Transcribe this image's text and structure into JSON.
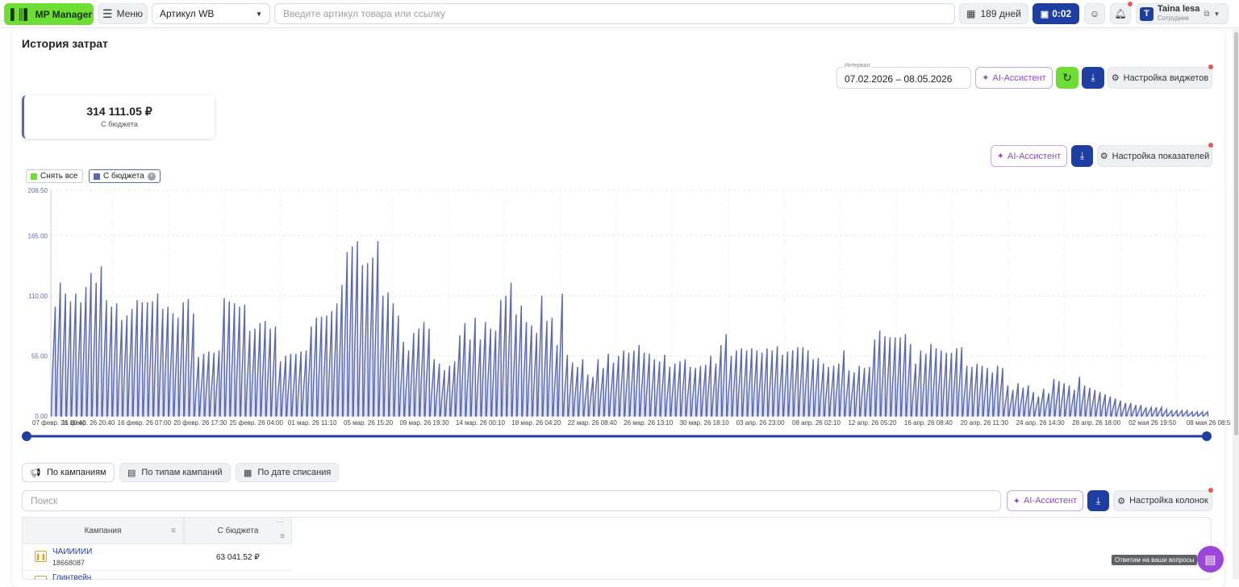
{
  "topbar": {
    "logo": "MP Manager",
    "menu": "Меню",
    "article_select": "Артикул WB",
    "search_placeholder": "Введите артикул товара или ссылку",
    "days": "189 дней",
    "timer": "0:02",
    "user_name": "Taina lesa",
    "user_role": "Сотрудник",
    "user_initial": "T"
  },
  "page": {
    "title": "История затрат",
    "interval_label": "Интервал",
    "interval_value": "07.02.2026 – 08.05.2026",
    "ai_label": "AI-Ассистент",
    "widgets_settings": "Настройка виджетов",
    "metrics_settings": "Настройка показателей",
    "columns_settings": "Настройка колонок"
  },
  "kpi": {
    "value": "314 111.05 ₽",
    "label": "С бюджета"
  },
  "legend": {
    "clear_all": "Снять все",
    "series": "С бюджета"
  },
  "colors": {
    "accent_green": "#6dde34",
    "primary_blue": "#1e3fa0",
    "series": "#5b69b0",
    "ai_purple": "#8b4cc4"
  },
  "tabs": [
    "По кампаниям",
    "По типам кампаний",
    "По дате списания"
  ],
  "table": {
    "search_placeholder": "Поиск",
    "headers": [
      "Кампания",
      "С бюджета"
    ],
    "rows": [
      {
        "name": "ЧАИИИИИ",
        "id": "18668087",
        "value": "63 041.52 ₽"
      },
      {
        "name": "Глинтвейн",
        "id": "",
        "value": ""
      }
    ]
  },
  "help_tooltip": "Ответим на ваши вопросы",
  "chart_data": {
    "type": "area",
    "title": "",
    "y_ticks": [
      "0.00",
      "55.00",
      "110.00",
      "165.00",
      "206.50"
    ],
    "ylim": [
      0,
      206.5
    ],
    "x_labels": [
      "07 февр. 26 10:40",
      "11 февр. 26 20:40",
      "16 февр. 26 07:00",
      "20 февр. 26 17:30",
      "25 февр. 26 04:00",
      "01 мар. 26 11:10",
      "05 мар. 26 15:20",
      "09 мар. 26 19:30",
      "14 мар. 26 00:10",
      "18 мар. 26 04:20",
      "22 мар. 26 08:40",
      "26 мар. 26 13:10",
      "30 мар. 26 18:10",
      "03 апр. 26 23:00",
      "08 апр. 26 02:10",
      "12 апр. 26 05:20",
      "16 апр. 26 08:40",
      "20 апр. 26 11:30",
      "24 апр. 26 14:30",
      "28 апр. 26 18:00",
      "02 мая 26 19:50",
      "08 мая 26 08:5"
    ],
    "grid": true,
    "series": [
      {
        "name": "С бюджета",
        "peaks": [
          100,
          122,
          112,
          105,
          112,
          104,
          118,
          131,
          122,
          137,
          106,
          100,
          103,
          88,
          92,
          98,
          106,
          104,
          104,
          105,
          112,
          98,
          100,
          94,
          90,
          104,
          107,
          94,
          54,
          57,
          59,
          58,
          60,
          108,
          105,
          103,
          100,
          102,
          78,
          80,
          85,
          87,
          80,
          82,
          50,
          55,
          57,
          57,
          59,
          60,
          82,
          90,
          91,
          92,
          96,
          103,
          120,
          150,
          155,
          160,
          138,
          140,
          145,
          160,
          110,
          113,
          103,
          92,
          68,
          60,
          76,
          80,
          86,
          80,
          52,
          48,
          42,
          46,
          50,
          74,
          85,
          70,
          90,
          70,
          86,
          80,
          78,
          106,
          110,
          122,
          93,
          101,
          86,
          83,
          76,
          110,
          87,
          90,
          65,
          112,
          56,
          49,
          45,
          52,
          38,
          36,
          52,
          44,
          57,
          49,
          55,
          60,
          58,
          60,
          65,
          58,
          57,
          52,
          50,
          56,
          45,
          48,
          50,
          52,
          45,
          44,
          46,
          47,
          55,
          48,
          65,
          75,
          55,
          60,
          62,
          60,
          62,
          60,
          58,
          62,
          60,
          64,
          56,
          59,
          60,
          63,
          63,
          60,
          52,
          53,
          48,
          45,
          46,
          48,
          60,
          42,
          40,
          46,
          44,
          45,
          70,
          78,
          73,
          72,
          72,
          72,
          75,
          66,
          48,
          60,
          57,
          66,
          62,
          60,
          58,
          58,
          62,
          63,
          46,
          45,
          48,
          46,
          44,
          40,
          46,
          44,
          28,
          24,
          30,
          26,
          28,
          22,
          18,
          25,
          21,
          34,
          32,
          30,
          28,
          24,
          36,
          28,
          26,
          24,
          22,
          20,
          18,
          16,
          14,
          12,
          12,
          10,
          10,
          8,
          8,
          8,
          8,
          6,
          5,
          5,
          5,
          5,
          4,
          4,
          4,
          4
        ]
      }
    ]
  }
}
